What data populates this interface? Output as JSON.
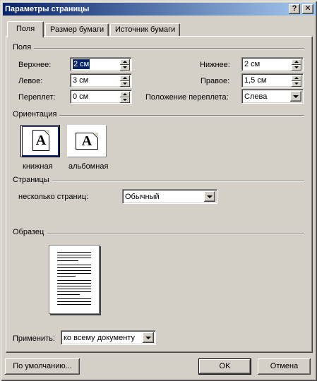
{
  "window": {
    "title": "Параметры страницы",
    "help_glyph": "?",
    "close_glyph": "✕"
  },
  "tabs": [
    {
      "label": "Поля",
      "active": true
    },
    {
      "label": "Размер бумаги",
      "active": false
    },
    {
      "label": "Источник бумаги",
      "active": false
    }
  ],
  "margins": {
    "group_label": "Поля",
    "top": {
      "label": "Верхнее:",
      "value": "2 см"
    },
    "bottom": {
      "label": "Нижнее:",
      "value": "2 см"
    },
    "left": {
      "label": "Левое:",
      "value": "3 см"
    },
    "right": {
      "label": "Правое:",
      "value": "1,5 см"
    },
    "gutter": {
      "label": "Переплет:",
      "value": "0 см"
    },
    "gutter_position": {
      "label": "Положение переплета:",
      "value": "Слева"
    }
  },
  "orientation": {
    "group_label": "Ориентация",
    "portrait": {
      "label": "книжная",
      "icon_letter": "A",
      "selected": true
    },
    "landscape": {
      "label": "альбомная",
      "icon_letter": "A",
      "selected": false
    }
  },
  "pages": {
    "group_label": "Страницы",
    "multiple_label": "несколько страниц:",
    "multiple_value": "Обычный"
  },
  "preview": {
    "group_label": "Образец",
    "apply_label": "Применить:",
    "apply_value": "ко всему документу"
  },
  "buttons": {
    "default": "По умолчанию...",
    "ok": "OK",
    "cancel": "Отмена"
  },
  "colors": {
    "titlebar_start": "#0a246a",
    "titlebar_end": "#a6caf0",
    "face": "#d4d0c8",
    "selection": "#0a246a"
  }
}
